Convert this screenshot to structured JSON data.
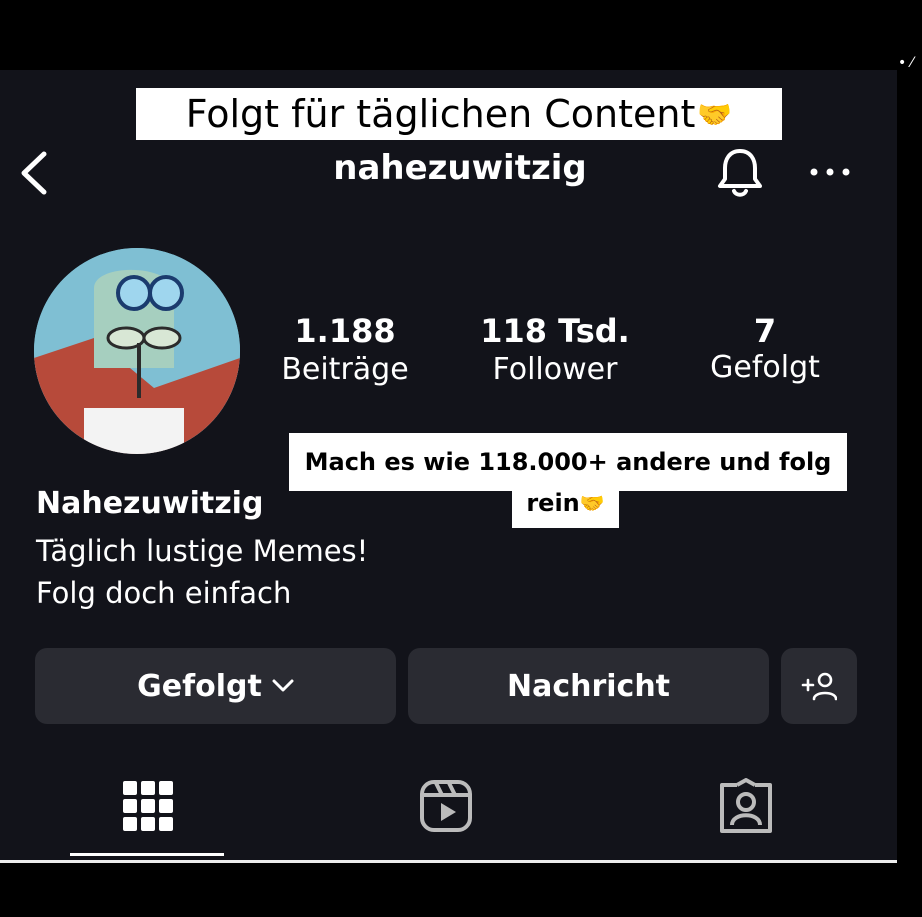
{
  "caption_top": {
    "text": "Folgt für täglichen Content",
    "emoji": "🤝"
  },
  "header": {
    "username": "nahezuwitzig"
  },
  "stats": {
    "posts": {
      "value": "1.188",
      "label": "Beiträge"
    },
    "followers": {
      "value": "118 Tsd.",
      "label": "Follower"
    },
    "following": {
      "value": "7",
      "label": "Gefolgt"
    }
  },
  "overlay": {
    "line1": "Mach es wie 118.000+ andere und folg",
    "line2": "rein",
    "emoji": "🤝"
  },
  "profile": {
    "name": "Nahezuwitzig",
    "bio_line1": "Täglich lustige Memes!",
    "bio_line2": "Folg doch einfach"
  },
  "buttons": {
    "follow_label": "Gefolgt",
    "message_label": "Nachricht"
  },
  "icons": [
    "back-icon",
    "bell-icon",
    "more-icon",
    "chevron-down-icon",
    "add-person-icon",
    "grid-icon",
    "reels-icon",
    "tagged-icon"
  ],
  "colors": {
    "background": "#12131a",
    "button": "#2a2b32",
    "text": "#ffffff"
  }
}
